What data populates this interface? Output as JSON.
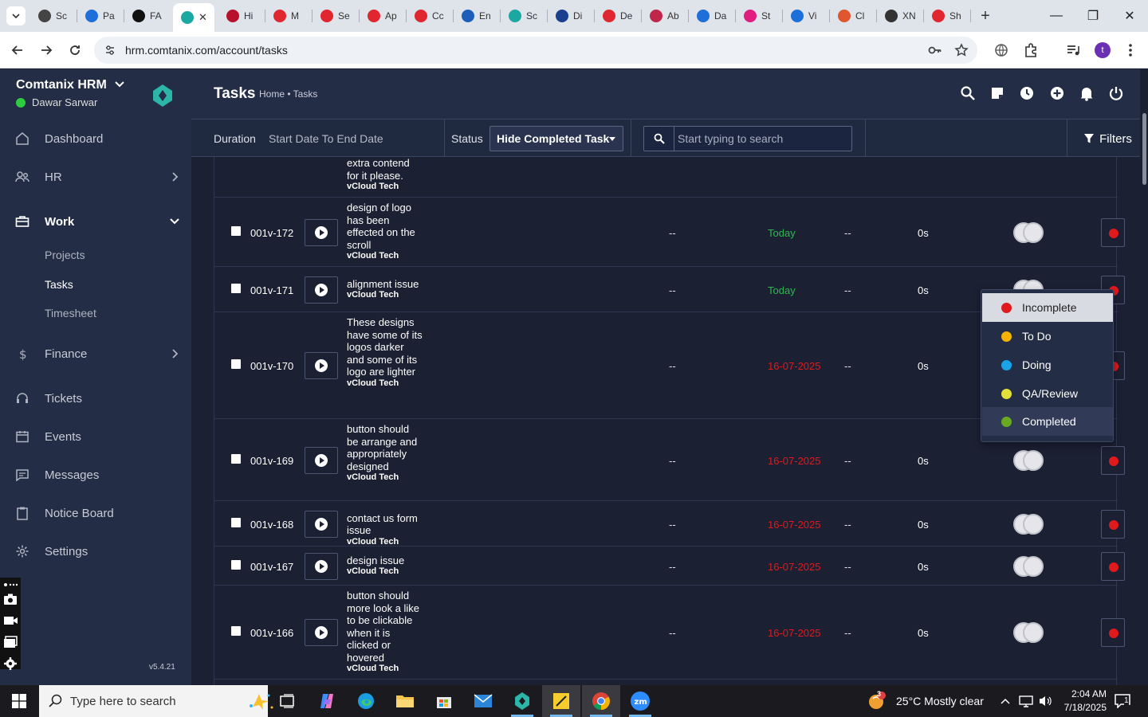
{
  "browser": {
    "tabs": [
      {
        "label": "Sc",
        "color": "#444"
      },
      {
        "label": "Pa",
        "color": "#1e6fd9"
      },
      {
        "label": "FA",
        "color": "#111"
      },
      {
        "label": "",
        "color": "#1ba8a0",
        "active": true
      },
      {
        "label": "Hi",
        "color": "#b8102d"
      },
      {
        "label": "M",
        "color": "#e0262e"
      },
      {
        "label": "Se",
        "color": "#e0262e"
      },
      {
        "label": "Ap",
        "color": "#e0262e"
      },
      {
        "label": "Cc",
        "color": "#e0262e"
      },
      {
        "label": "En",
        "color": "#1d5fb8"
      },
      {
        "label": "Sc",
        "color": "#1ba8a0"
      },
      {
        "label": "Di",
        "color": "#1a3f8f"
      },
      {
        "label": "De",
        "color": "#e0262e"
      },
      {
        "label": "Ab",
        "color": "#c0254a"
      },
      {
        "label": "Da",
        "color": "#1e6fd9"
      },
      {
        "label": "St",
        "color": "#e01e80"
      },
      {
        "label": "Vi",
        "color": "#1e6fd9"
      },
      {
        "label": "Cl",
        "color": "#e0562e"
      },
      {
        "label": "XN",
        "color": "#333"
      },
      {
        "label": "Sh",
        "color": "#e0262e"
      }
    ],
    "active_tab_close": "✕",
    "new_tab": "+",
    "url": "hrm.comtanix.com/account/tasks",
    "profile_initial": "t",
    "window_buttons": [
      "—",
      "❐",
      "✕"
    ]
  },
  "sidebar": {
    "brand": "Comtanix HRM",
    "user": "Dawar Sarwar",
    "menu": [
      {
        "label": "Dashboard",
        "icon": "home-icon"
      },
      {
        "label": "HR",
        "icon": "users-icon"
      },
      {
        "label": "Work",
        "icon": "briefcase-icon"
      },
      {
        "label": "Finance",
        "icon": "dollar-icon"
      },
      {
        "label": "Tickets",
        "icon": "headset-icon"
      },
      {
        "label": "Events",
        "icon": "calendar-icon"
      },
      {
        "label": "Messages",
        "icon": "message-icon"
      },
      {
        "label": "Notice Board",
        "icon": "clipboard-icon"
      },
      {
        "label": "Settings",
        "icon": "gear-icon"
      }
    ],
    "work_sub": [
      "Projects",
      "Tasks",
      "Timesheet"
    ],
    "version": "v5.4.21"
  },
  "header": {
    "title": "Tasks",
    "breadcrumb": "Home • Tasks"
  },
  "filters": {
    "duration_label": "Duration",
    "duration_value": "Start Date To End Date",
    "status_label": "Status",
    "status_value": "Hide Completed Task",
    "search_placeholder": "Start typing to search",
    "filters_button": "Filters"
  },
  "partial_row": {
    "name": "extra contend for it please.",
    "project": "vCloud Tech"
  },
  "tasks": [
    {
      "id": "001v-172",
      "name": "design of logo has been effected on the scroll",
      "project": "vCloud Tech",
      "col1": "--",
      "due": "Today",
      "due_state": "today",
      "col2": "--",
      "time": "0s"
    },
    {
      "id": "001v-171",
      "name": "alignment issue",
      "project": "vCloud Tech",
      "col1": "--",
      "due": "Today",
      "due_state": "today",
      "col2": "--",
      "time": "0s"
    },
    {
      "id": "001v-170",
      "name": "These designs have some of its logos darker and some of its logo are lighter",
      "project": "vCloud Tech",
      "col1": "--",
      "due": "16-07-2025",
      "due_state": "late",
      "col2": "--",
      "time": "0s"
    },
    {
      "id": "001v-169",
      "name": "button should be arrange and appropriately designed",
      "project": "vCloud Tech",
      "col1": "--",
      "due": "16-07-2025",
      "due_state": "late",
      "col2": "--",
      "time": "0s"
    },
    {
      "id": "001v-168",
      "name": "contact us form issue",
      "project": "vCloud Tech",
      "col1": "--",
      "due": "16-07-2025",
      "due_state": "late",
      "col2": "--",
      "time": "0s"
    },
    {
      "id": "001v-167",
      "name": "design issue",
      "project": "vCloud Tech",
      "col1": "--",
      "due": "16-07-2025",
      "due_state": "late",
      "col2": "--",
      "time": "0s"
    },
    {
      "id": "001v-166",
      "name": "button should more look a like to be clickable when it is clicked or hovered",
      "project": "vCloud Tech",
      "col1": "--",
      "due": "16-07-2025",
      "due_state": "late",
      "col2": "--",
      "time": "0s"
    }
  ],
  "status_menu": [
    {
      "label": "Incomplete",
      "color": "#e0191c"
    },
    {
      "label": "To Do",
      "color": "#f5b400"
    },
    {
      "label": "Doing",
      "color": "#1aa3e8"
    },
    {
      "label": "QA/Review",
      "color": "#e4e03a"
    },
    {
      "label": "Completed",
      "color": "#6aaa23"
    }
  ],
  "colors": {
    "sidebar_bg": "#232d45",
    "content_bg": "#1c2033",
    "late": "#e0191c",
    "today": "#2db84d"
  },
  "taskbar": {
    "search_placeholder": "Type here to search",
    "weather": "25°C  Mostly clear",
    "weather_badge": "3",
    "time": "2:04 AM",
    "date": "7/18/2025",
    "notif_count": "1"
  }
}
